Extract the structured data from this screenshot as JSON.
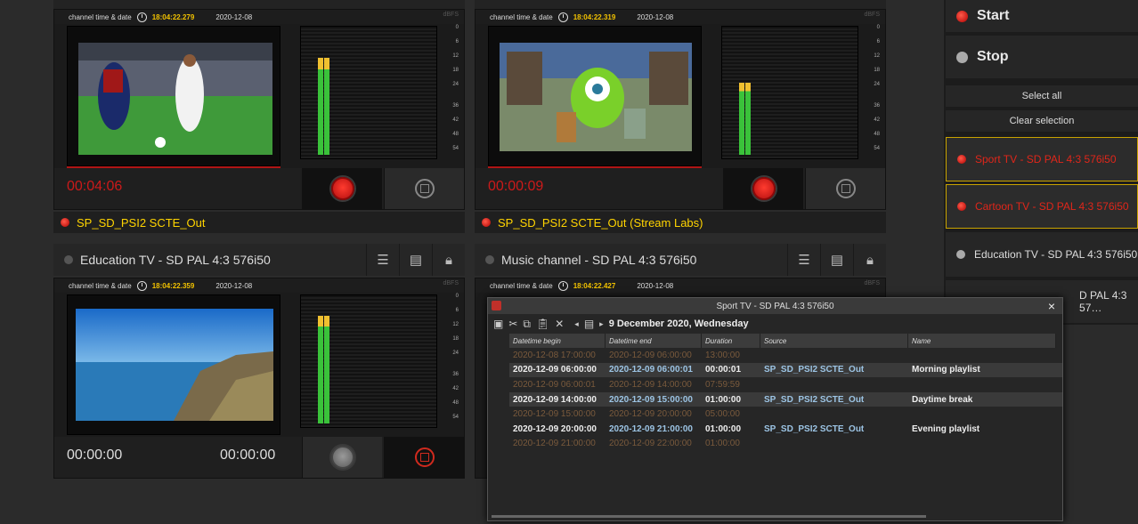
{
  "info": {
    "label": "channel  time & date",
    "unit": "dBFS"
  },
  "scale_ticks": [
    "0",
    "6",
    "12",
    "18",
    "24",
    "36",
    "42",
    "48",
    "54"
  ],
  "channels": [
    {
      "time": "18:04:22.279",
      "date": "2020-12-08",
      "timer": "00:04:06",
      "output": "SP_SD_PSI2 SCTE_Out",
      "meter_left": 0.82,
      "meter_right": 0.82
    },
    {
      "time": "18:04:22.319",
      "date": "2020-12-08",
      "timer": "00:00:09",
      "output": "SP_SD_PSI2 SCTE_Out (Stream Labs)",
      "meter_left": 0.62,
      "meter_right": 0.62
    },
    {
      "title": "Education TV - SD PAL 4:3 576i50",
      "time": "18:04:22.359",
      "date": "2020-12-08",
      "timer_a": "00:00:00",
      "timer_b": "00:00:00",
      "meter_left": 0.93,
      "meter_right": 0.93
    },
    {
      "title": "Music channel - SD PAL 4:3 576i50",
      "time": "18:04:22.427",
      "date": "2020-12-08"
    }
  ],
  "sidebar": {
    "start": "Start",
    "stop": "Stop",
    "select_all": "Select all",
    "clear_selection": "Clear selection",
    "items": [
      {
        "label": "Sport TV - SD PAL 4:3 576i50"
      },
      {
        "label": "Cartoon TV - SD PAL 4:3 576i50"
      },
      {
        "label": "Education TV - SD PAL 4:3 576i50"
      },
      {
        "label": "D PAL 4:3 57…"
      }
    ]
  },
  "dialog": {
    "title": "Sport TV - SD PAL 4:3 576i50",
    "close": "×",
    "date": "9 December 2020, Wednesday",
    "columns": [
      "Datetime begin",
      "Datetime end",
      "Duration",
      "Source",
      "Name"
    ],
    "rows": [
      {
        "begin": "2020-12-08 17:00:00",
        "end": "2020-12-09 06:00:00",
        "duration": "13:00:00",
        "source": "",
        "name": "",
        "kind": "gap"
      },
      {
        "begin": "2020-12-09 06:00:00",
        "end": "2020-12-09 06:00:01",
        "duration": "00:00:01",
        "source": "SP_SD_PSI2 SCTE_Out",
        "name": "Morning playlist",
        "kind": "ev"
      },
      {
        "begin": "2020-12-09 06:00:01",
        "end": "2020-12-09 14:00:00",
        "duration": "07:59:59",
        "source": "",
        "name": "",
        "kind": "gap"
      },
      {
        "begin": "2020-12-09 14:00:00",
        "end": "2020-12-09 15:00:00",
        "duration": "01:00:00",
        "source": "SP_SD_PSI2 SCTE_Out",
        "name": "Daytime break",
        "kind": "ev"
      },
      {
        "begin": "2020-12-09 15:00:00",
        "end": "2020-12-09 20:00:00",
        "duration": "05:00:00",
        "source": "",
        "name": "",
        "kind": "gap"
      },
      {
        "begin": "2020-12-09 20:00:00",
        "end": "2020-12-09 21:00:00",
        "duration": "01:00:00",
        "source": "SP_SD_PSI2 SCTE_Out",
        "name": "Evening playlist",
        "kind": "ev2"
      },
      {
        "begin": "2020-12-09 21:00:00",
        "end": "2020-12-09 22:00:00",
        "duration": "01:00:00",
        "source": "",
        "name": "",
        "kind": "gap"
      }
    ]
  }
}
